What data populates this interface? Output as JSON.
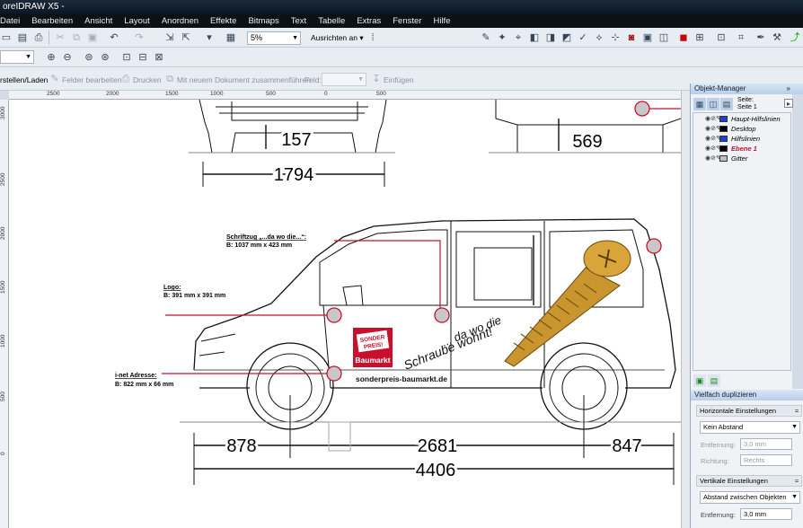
{
  "app": {
    "title": "oreIDRAW X5 -"
  },
  "menu": [
    "Datei",
    "Bearbeiten",
    "Ansicht",
    "Layout",
    "Anordnen",
    "Effekte",
    "Bitmaps",
    "Text",
    "Tabelle",
    "Extras",
    "Fenster",
    "Hilfe"
  ],
  "toolbar": {
    "zoom": "5%",
    "snap": "Ausrichten an"
  },
  "toolbar3": {
    "left": "rstellen/Laden",
    "felder": "Felder bearbeiten",
    "drucken": "Drucken",
    "merge": "Mit neuem Dokument zusammenführen",
    "feld_label": "Feld:",
    "einfuegen": "Einfügen"
  },
  "ruler": {
    "h": [
      "2500",
      "2000",
      "1500",
      "1000",
      "500",
      "0",
      "500"
    ],
    "v": [
      "3000",
      "2500",
      "2000",
      "1500",
      "1000",
      "500",
      "0"
    ]
  },
  "drawing": {
    "dim_front_height": "157",
    "dim_front_width": "1794",
    "dim_side_height": "569",
    "dim_a": "878",
    "dim_b": "2681",
    "dim_c": "847",
    "dim_total": "4406",
    "note_schriftzug_title": "Schriftzug „...da wo die...“:",
    "note_schriftzug_size": "B: 1037 mm x 423 mm",
    "note_logo_title": "Logo:",
    "note_logo_size": "B: 391 mm x 391 mm",
    "note_inet_title": "i-net Adresse:",
    "note_inet_size": "B: 822 mm x 66 mm",
    "logo_line1": "SONDER",
    "logo_line2": "PREIS!",
    "logo_brand": "Baumarkt",
    "slogan_line1": "... da wo die",
    "slogan_line2": "Schraube wohnt!",
    "url": "sonderpreis-baumarkt.de"
  },
  "object_manager": {
    "title": "Objekt-Manager",
    "seite_label": "Seite:",
    "seite_value": "Seite 1",
    "layers": [
      {
        "name": "Haupt-Hilfslinien",
        "color": "#1f3fd0"
      },
      {
        "name": "Desktop",
        "color": "#000000"
      },
      {
        "name": "Hilfslinien",
        "color": "#1f3fd0"
      },
      {
        "name": "Ebene 1",
        "color": "#000000",
        "active": true
      },
      {
        "name": "Gitter",
        "color": "#c0c0c0"
      }
    ]
  },
  "duplicate": {
    "title": "Vielfach duplizieren",
    "h_title": "Horizontale Einstellungen",
    "h_mode": "Kein Abstand",
    "h_dist_label": "Entfernung:",
    "h_dist_value": "3,0 mm",
    "h_dir_label": "Richtung:",
    "h_dir_value": "Rechts",
    "v_title": "Vertikale Einstellungen",
    "v_mode": "Abstand zwischen Objekten",
    "v_dist_label": "Entfernung:",
    "v_dist_value": "3,0 mm"
  },
  "colors": {
    "accent": "#c8102e",
    "marker": "#d0303a"
  }
}
